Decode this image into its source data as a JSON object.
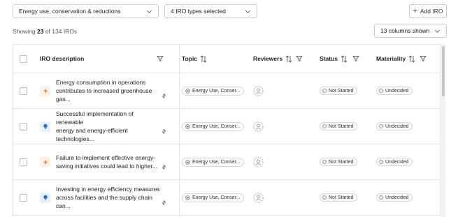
{
  "filters": {
    "topic_select": "Energy use, conservation & reductions",
    "types_select": "4 IRO types selected",
    "add_button": "Add IRO"
  },
  "summary": {
    "prefix": "Showing",
    "shown": "23",
    "middle": "of 134 IROs"
  },
  "columns_select": "13 columns shown",
  "headers": {
    "description": "IRO description",
    "topic": "Topic",
    "reviewers": "Reviewers",
    "status": "Status",
    "materiality": "Materiality"
  },
  "rows": [
    {
      "type_icon": "lightning-icon",
      "line1": "Energy consumption in operations",
      "line2": "contributes to increased greenhouse gas...",
      "topic": "Energy Use, Conser...",
      "status": "Not Started",
      "materiality": "Undecided"
    },
    {
      "type_icon": "lightbulb-icon",
      "line1": "Successful implementation of renewable",
      "line2": "energy and energy-efficient technologies...",
      "topic": "Energy Use, Conser...",
      "status": "Not Started",
      "materiality": "Undecided"
    },
    {
      "type_icon": "lightning-icon",
      "line1": "Failure to implement effective energy-",
      "line2": "saving initiatives could lead to higher...",
      "topic": "Energy Use, Conser...",
      "status": "Not Started",
      "materiality": "Undecided"
    },
    {
      "type_icon": "lightbulb-icon",
      "line1": "Investing in energy efficiency measures",
      "line2": "across facilities and the supply chain can...",
      "topic": "Energy Use, Conser...",
      "status": "Not Started",
      "materiality": "Undecided"
    }
  ],
  "colors": {
    "negative_icon": "#f26b1d",
    "positive_icon": "#1f6fe0",
    "border": "#e2e4e8"
  }
}
